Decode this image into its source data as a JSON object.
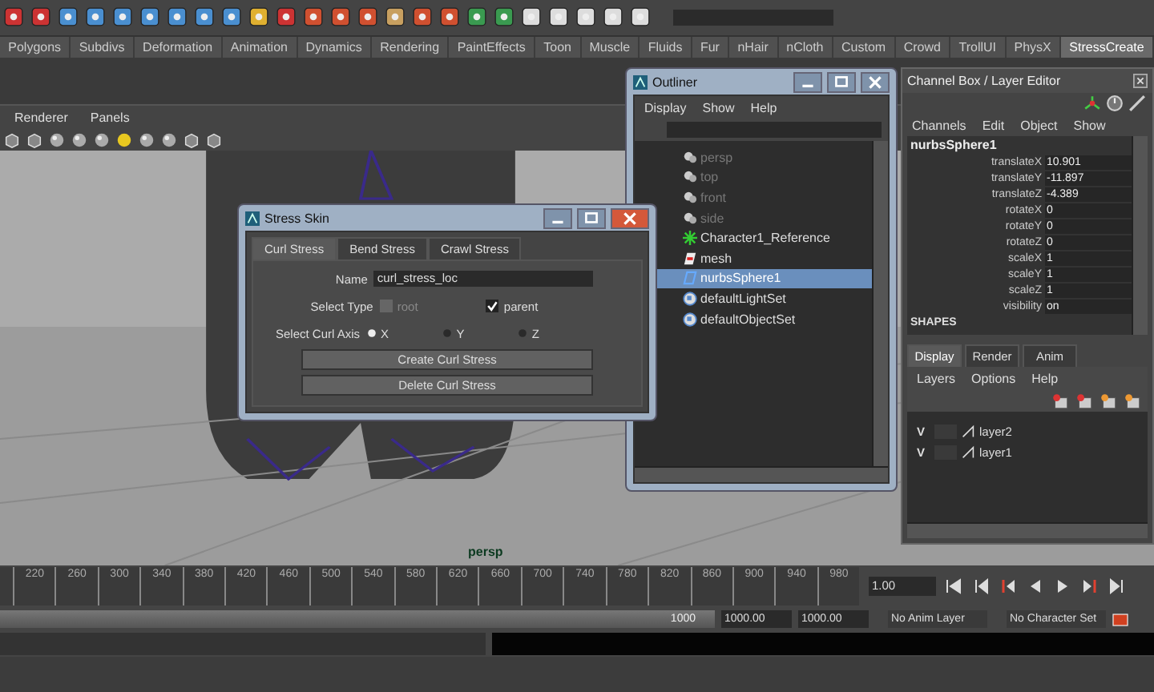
{
  "shelf_tabs": [
    {
      "label": "Polygons",
      "selected": false
    },
    {
      "label": "Subdivs",
      "selected": false
    },
    {
      "label": "Deformation",
      "selected": false
    },
    {
      "label": "Animation",
      "selected": false
    },
    {
      "label": "Dynamics",
      "selected": false
    },
    {
      "label": "Rendering",
      "selected": false
    },
    {
      "label": "PaintEffects",
      "selected": false
    },
    {
      "label": "Toon",
      "selected": false
    },
    {
      "label": "Muscle",
      "selected": false
    },
    {
      "label": "Fluids",
      "selected": false
    },
    {
      "label": "Fur",
      "selected": false
    },
    {
      "label": "nHair",
      "selected": false
    },
    {
      "label": "nCloth",
      "selected": false
    },
    {
      "label": "Custom",
      "selected": false
    },
    {
      "label": "Crowd",
      "selected": false
    },
    {
      "label": "TrollUI",
      "selected": false
    },
    {
      "label": "PhysX",
      "selected": false
    },
    {
      "label": "StressCreate",
      "selected": true
    }
  ],
  "viewport": {
    "menu": [
      "Renderer",
      "Panels"
    ],
    "camera_label": "persp"
  },
  "stress_skin": {
    "title": "Stress Skin",
    "tabs": [
      {
        "label": "Curl Stress",
        "selected": true
      },
      {
        "label": "Bend Stress",
        "selected": false
      },
      {
        "label": "Crawl Stress",
        "selected": false
      }
    ],
    "name_label": "Name",
    "name_value": "curl_stress_loc",
    "type_label": "Select Type",
    "type_options": [
      {
        "label": "root",
        "checked": false,
        "disabled": true
      },
      {
        "label": "parent",
        "checked": true,
        "disabled": false
      }
    ],
    "axis_label": "Select Curl Axis",
    "axes": [
      {
        "label": "X",
        "selected": true
      },
      {
        "label": "Y",
        "selected": false
      },
      {
        "label": "Z",
        "selected": false
      }
    ],
    "buttons": [
      "Create Curl Stress",
      "Delete Curl Stress"
    ]
  },
  "outliner": {
    "title": "Outliner",
    "menu": [
      "Display",
      "Show",
      "Help"
    ],
    "items": [
      {
        "label": "persp",
        "kind": "camera",
        "dimmed": true,
        "selected": false
      },
      {
        "label": "top",
        "kind": "camera",
        "dimmed": true,
        "selected": false
      },
      {
        "label": "front",
        "kind": "camera",
        "dimmed": true,
        "selected": false
      },
      {
        "label": "side",
        "kind": "camera",
        "dimmed": true,
        "selected": false
      },
      {
        "label": "Character1_Reference",
        "kind": "reference",
        "dimmed": false,
        "selected": false
      },
      {
        "label": "mesh",
        "kind": "mesh",
        "dimmed": false,
        "selected": false
      },
      {
        "label": "nurbsSphere1",
        "kind": "nurbs",
        "dimmed": false,
        "selected": true
      },
      {
        "label": "defaultLightSet",
        "kind": "set",
        "dimmed": false,
        "selected": false
      },
      {
        "label": "defaultObjectSet",
        "kind": "set",
        "dimmed": false,
        "selected": false
      }
    ]
  },
  "channel_box": {
    "title": "Channel Box / Layer Editor",
    "menu": [
      "Channels",
      "Edit",
      "Object",
      "Show"
    ],
    "object": "nurbsSphere1",
    "channels": [
      {
        "name": "translateX",
        "value": "10.901"
      },
      {
        "name": "translateY",
        "value": "-11.897"
      },
      {
        "name": "translateZ",
        "value": "-4.389"
      },
      {
        "name": "rotateX",
        "value": "0"
      },
      {
        "name": "rotateY",
        "value": "0"
      },
      {
        "name": "rotateZ",
        "value": "0"
      },
      {
        "name": "scaleX",
        "value": "1"
      },
      {
        "name": "scaleY",
        "value": "1"
      },
      {
        "name": "scaleZ",
        "value": "1"
      },
      {
        "name": "visibility",
        "value": "on"
      }
    ],
    "section": "SHAPES",
    "tabs": [
      {
        "label": "Display",
        "selected": true
      },
      {
        "label": "Render",
        "selected": false
      },
      {
        "label": "Anim",
        "selected": false
      }
    ],
    "layer_menu": [
      "Layers",
      "Options",
      "Help"
    ],
    "layers": [
      {
        "visibility": "V",
        "playback": false,
        "name": "layer2"
      },
      {
        "visibility": "V",
        "playback": false,
        "name": "layer1"
      }
    ]
  },
  "timeline": {
    "ticks": [
      "220",
      "260",
      "300",
      "340",
      "380",
      "420",
      "460",
      "500",
      "540",
      "580",
      "620",
      "660",
      "700",
      "740",
      "780",
      "820",
      "860",
      "900",
      "940",
      "980"
    ],
    "current_frame": "1.00"
  },
  "range": {
    "level": 1,
    "slider_value": "1000",
    "start": "1000.00",
    "end": "1000.00",
    "anim_layer": "No Anim Layer",
    "character_set": "No Character Set"
  }
}
